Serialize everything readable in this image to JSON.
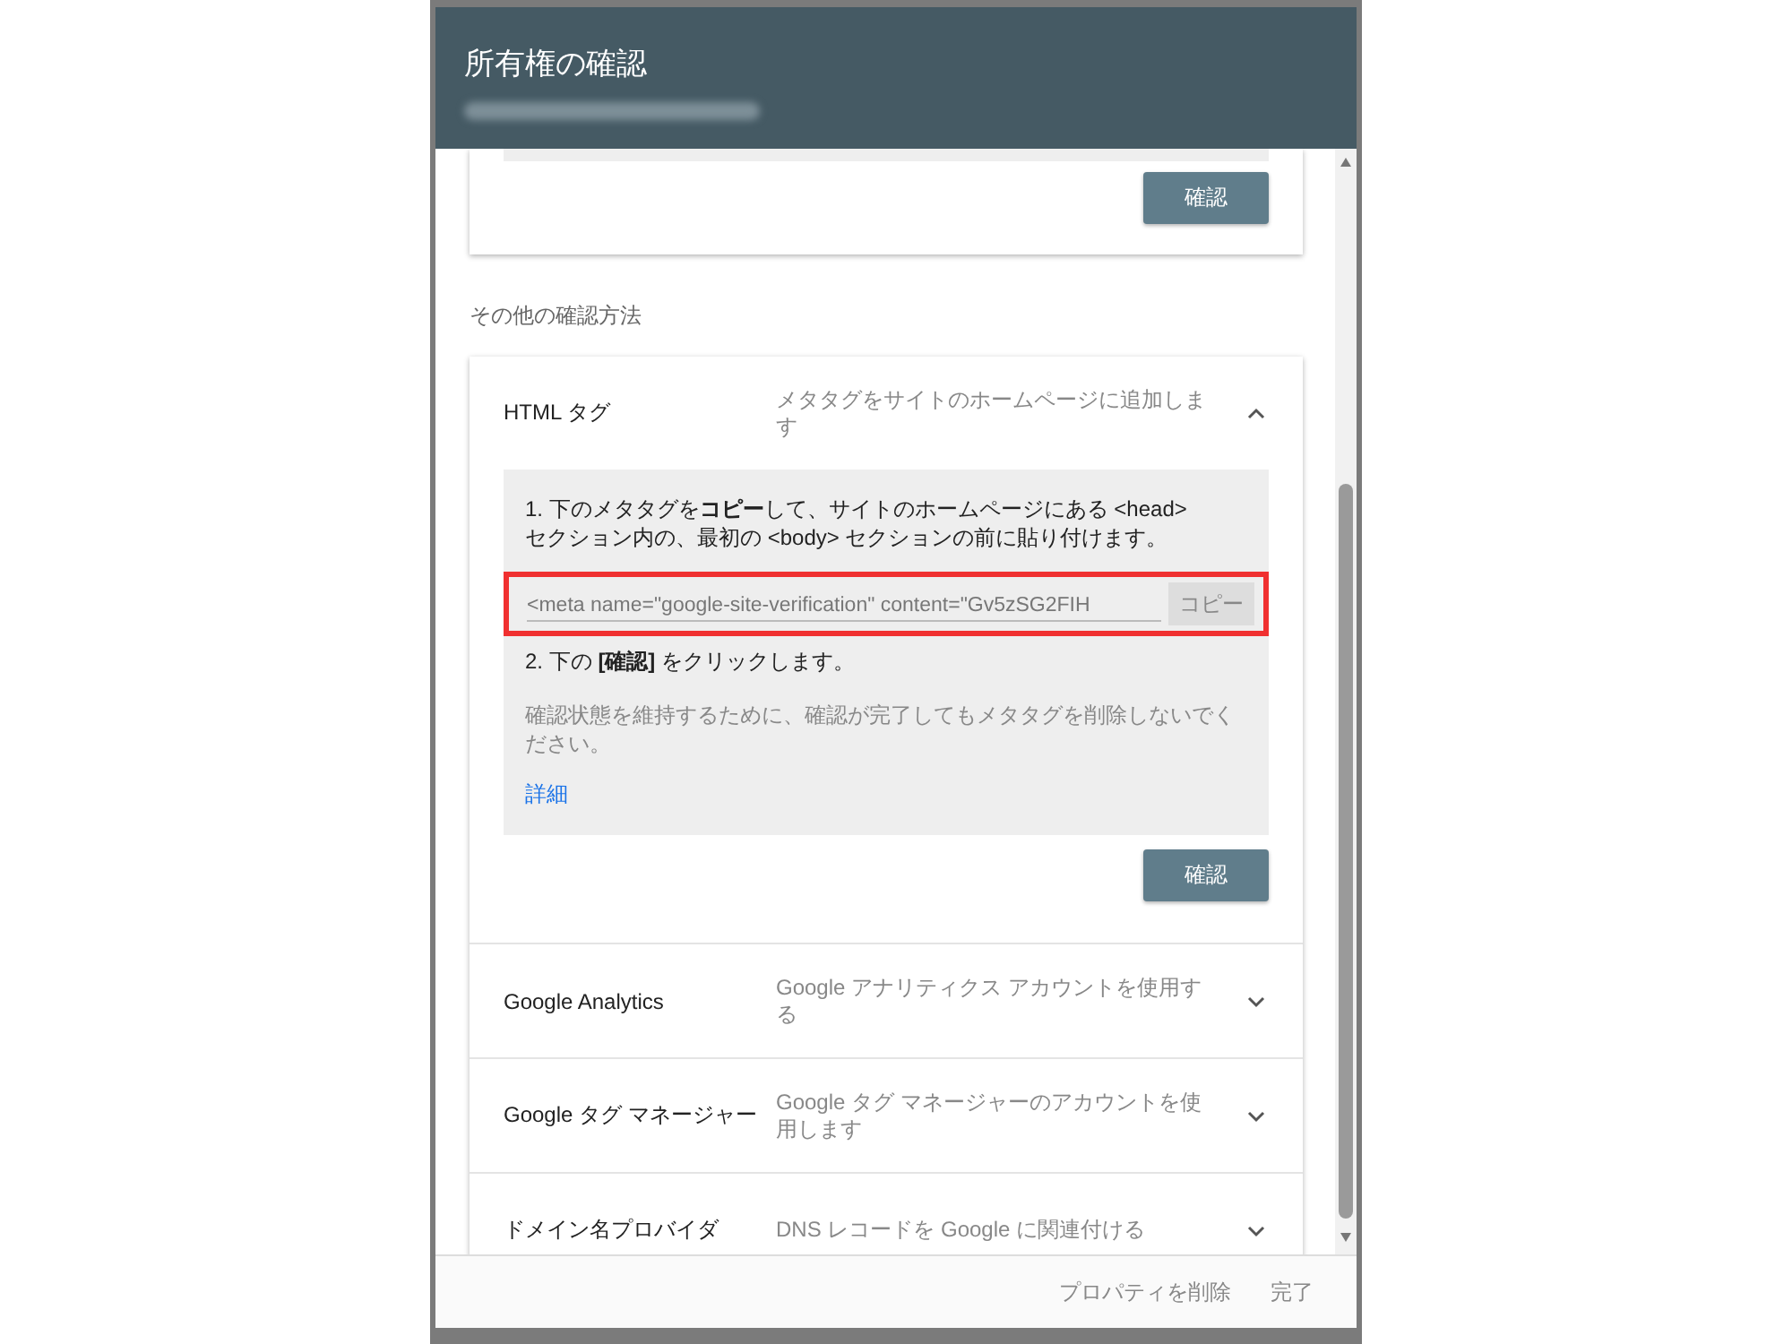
{
  "dialog": {
    "title": "所有権の確認"
  },
  "top_card": {
    "button": "確認"
  },
  "section_label": "その他の確認方法",
  "methods": [
    {
      "title": "HTML タグ",
      "description": "メタタグをサイトのホームページに追加します",
      "expanded": true,
      "details": {
        "step1": "1. 下のメタタグを**コピー**して、サイトのホームページにある <head> セクション内の、最初の <body> セクションの前に貼り付けます。",
        "meta_field": {
          "value": "<meta name=\"google-site-verification\" content=\"Gv5zSG2FIH",
          "highlighted": true
        },
        "copy_button": "コピー",
        "step2": "2. 下の **[確認]** をクリックします。",
        "note": "確認状態を維持するために、確認が完了してもメタタグを削除しないでください。",
        "link": "詳細",
        "button": "確認"
      }
    },
    {
      "title": "Google Analytics",
      "description": "Google アナリティクス アカウントを使用する",
      "expanded": false
    },
    {
      "title": "Google タグ マネージャー",
      "description": "Google タグ マネージャーのアカウントを使用します",
      "expanded": false
    },
    {
      "title": "ドメイン名プロバイダ",
      "description": "DNS レコードを Google に関連付ける",
      "expanded": false
    }
  ],
  "footer": {
    "buttons": [
      "プロパティを削除",
      "完了"
    ]
  }
}
